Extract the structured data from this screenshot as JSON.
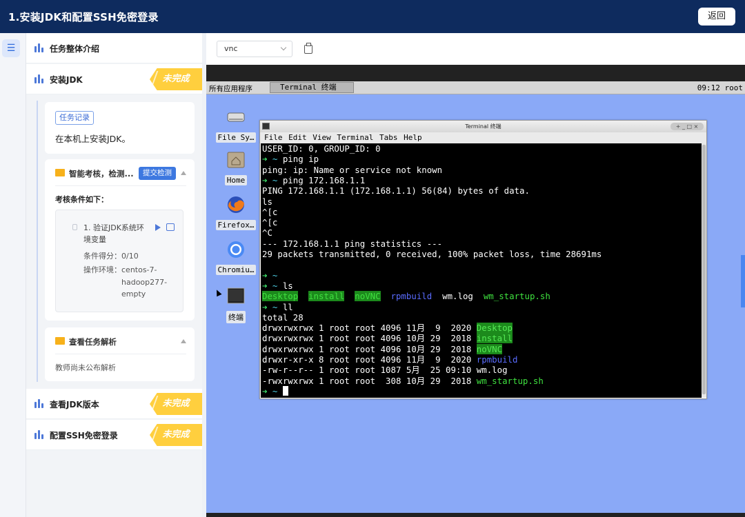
{
  "header": {
    "title": "1.安装JDK和配置SSH免密登录",
    "back_label": "返回"
  },
  "tasks": {
    "overview_label": "任务整体介绍",
    "items": [
      {
        "label": "安装JDK",
        "status": "未完成"
      },
      {
        "label": "查看JDK版本",
        "status": "未完成"
      },
      {
        "label": "配置SSH免密登录",
        "status": "未完成"
      }
    ]
  },
  "record": {
    "tag": "任务记录",
    "text": "在本机上安装JDK。"
  },
  "check": {
    "title": "智能考核，检测...",
    "submit_label": "提交检测",
    "conditions_title": "考核条件如下：",
    "condition_name": "1. 验证JDK系统环境变量",
    "score_label": "条件得分：",
    "score_value": "0/10",
    "env_label": "操作环境：",
    "env_value": "centos-7-hadoop277-empty"
  },
  "analysis": {
    "title": "查看任务解析",
    "text": "教师尚未公布解析"
  },
  "toolbar": {
    "select_value": "vnc"
  },
  "vnc": {
    "apps_menu": "所有应用程序",
    "taskbar_item": "Terminal 终端",
    "clock": "09:12 root",
    "desktop_icons": [
      "File Sy…",
      "Home",
      "Firefox…",
      "Chromiu…",
      "终端"
    ]
  },
  "terminal": {
    "window_title": "Terminal 终端",
    "menu": [
      "File",
      "Edit",
      "View",
      "Terminal",
      "Tabs",
      "Help"
    ],
    "lines": [
      "USER_ID: 0, GROUP_ID: 0",
      "ping ip",
      "ping: ip: Name or service not known",
      "ping 172.168.1.1",
      "PING 172.168.1.1 (172.168.1.1) 56(84) bytes of data.",
      "ls",
      "^[c",
      "^[c",
      "^C",
      "--- 172.168.1.1 ping statistics ---",
      "29 packets transmitted, 0 received, 100% packet loss, time 28691ms",
      "ls",
      "Desktop",
      "install",
      "noVNC",
      "rpmbuild",
      "wm.log",
      "wm_startup.sh",
      "ll",
      "total 28",
      "drwxrwxrwx 1 root root 4096 11月  9  2020 ",
      "drwxrwxrwx 1 root root 4096 10月 29  2018 ",
      "drwxrwxrwx 1 root root 4096 10月 29  2018 ",
      "drwxr-xr-x 8 root root 4096 11月  9  2020 ",
      "-rw-r--r-- 1 root root 1087 5月  25 09:10 wm.log",
      "-rwxrwxrwx 1 root root  308 10月 29  2018 ",
      "~"
    ]
  }
}
